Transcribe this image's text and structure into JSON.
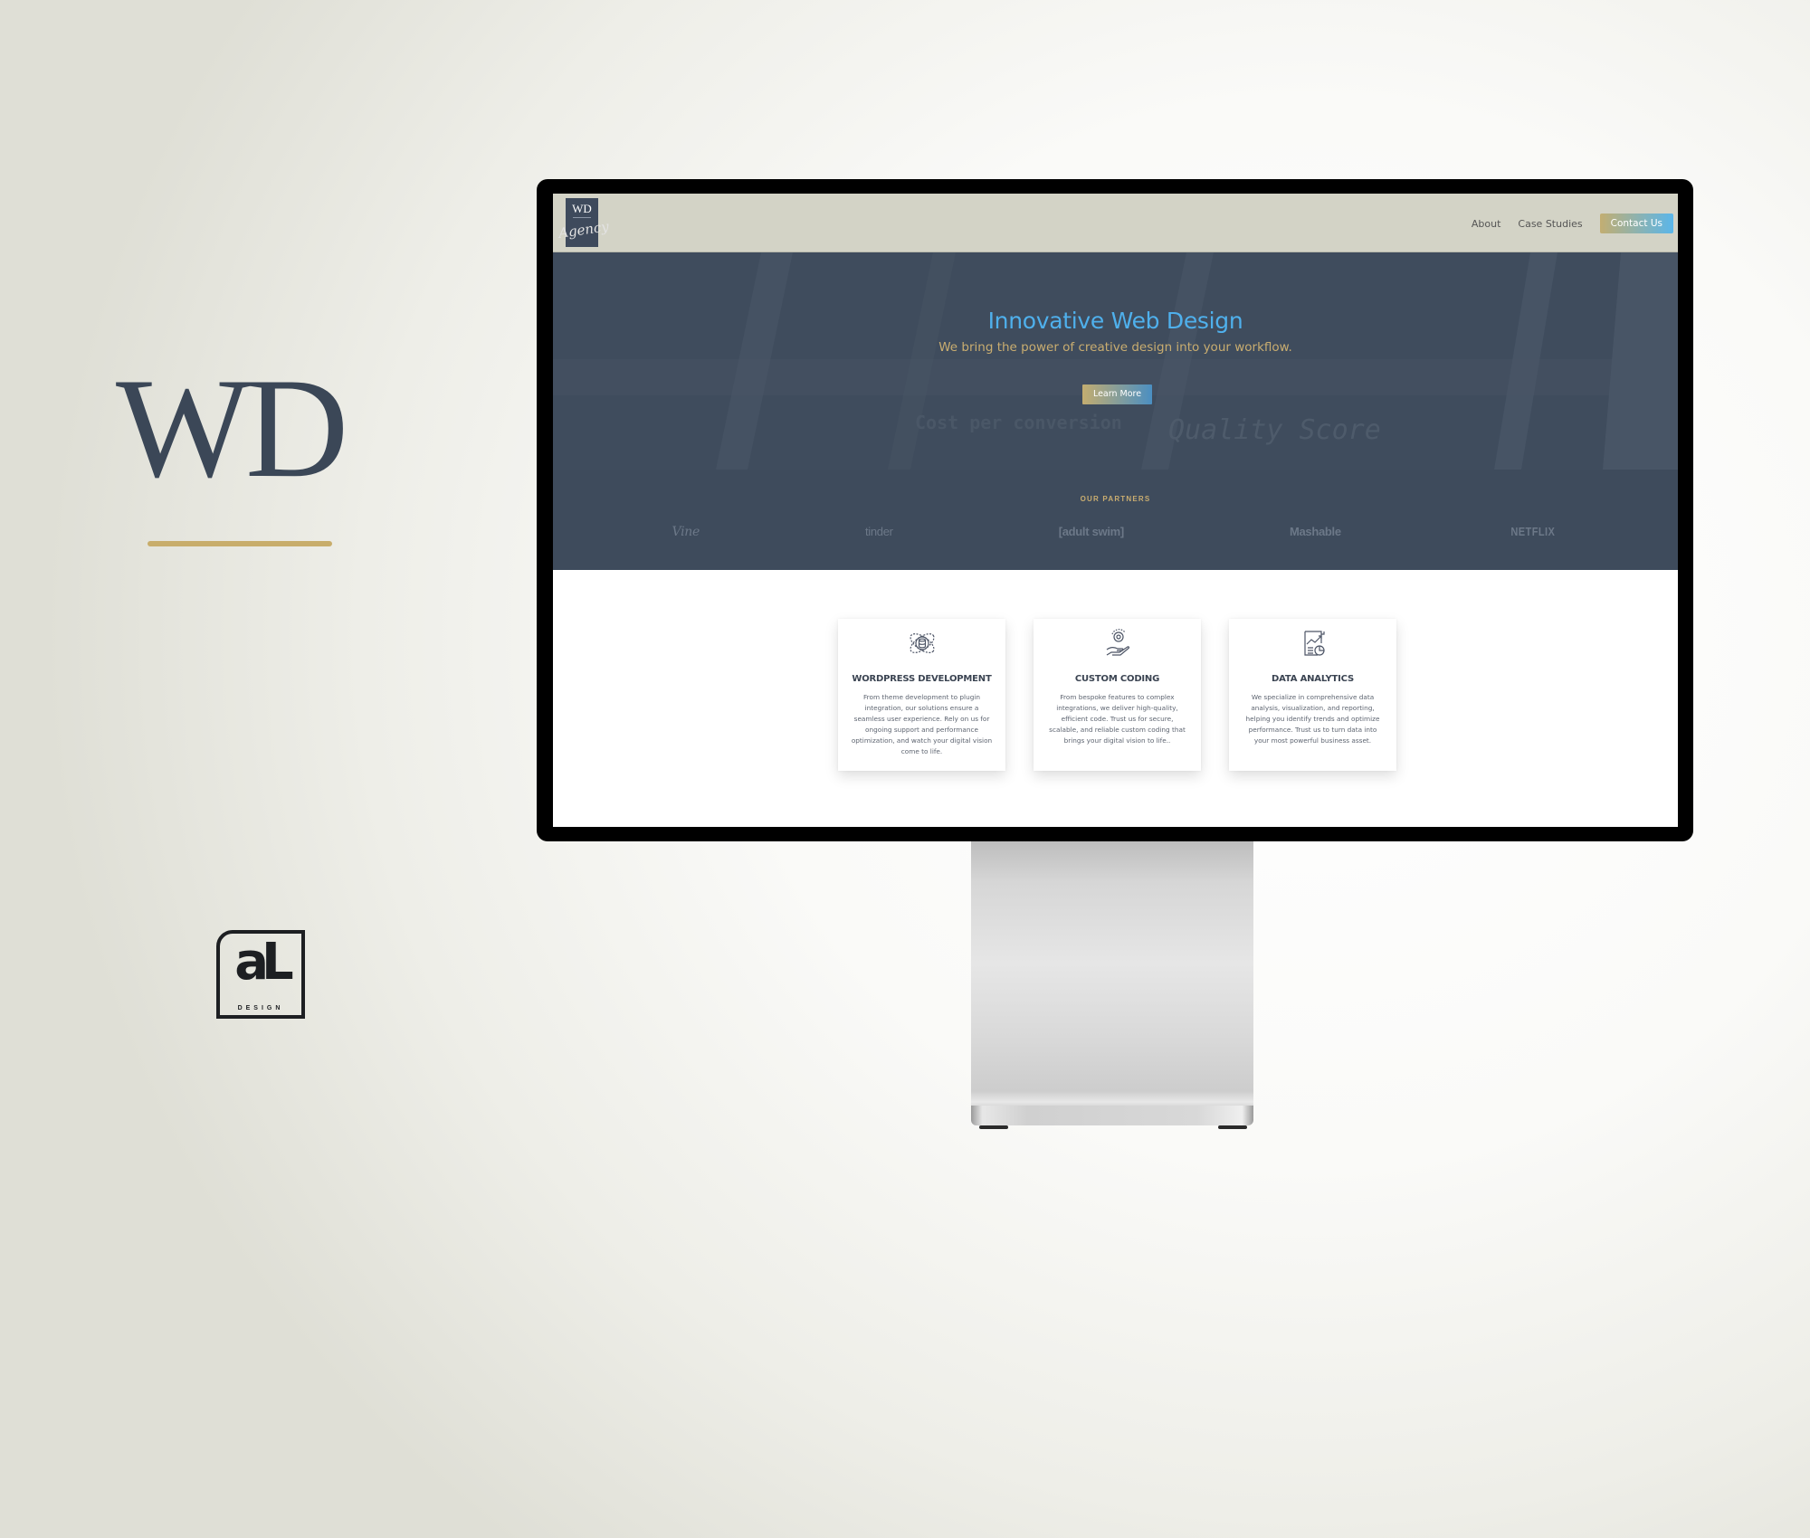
{
  "branding": {
    "monogram": "WD",
    "accent_color": "#c8ad6b",
    "secondary_logo": {
      "glyph": "aL",
      "subtitle": "DESIGN"
    }
  },
  "site": {
    "logo": {
      "monogram": "WD",
      "signature": "Agency"
    },
    "nav": {
      "links": [
        "About",
        "Case Studies"
      ],
      "cta_label": "Contact Us"
    },
    "hero": {
      "title": "Innovative Web Design",
      "subtitle": "We bring the power of creative design into your workflow.",
      "button_label": "Learn More",
      "background_text": [
        "Cost per conversion",
        "Quality Score"
      ]
    },
    "partners": {
      "title": "OUR PARTNERS",
      "logos": [
        "Vine",
        "tinder",
        "[adult swim]",
        "Mashable",
        "NETFLIX"
      ]
    },
    "services": [
      {
        "icon": "database-orbit-icon",
        "title": "WORDPRESS DEVELOPMENT",
        "text": "From theme development to plugin integration, our solutions ensure a seamless user experience. Rely on us for ongoing support and performance optimization, and watch your digital vision come to life."
      },
      {
        "icon": "hand-gear-icon",
        "title": "CUSTOM CODING",
        "text": "From bespoke features to complex integrations, we deliver high-quality, efficient code. Trust us for secure, scalable, and reliable custom coding that brings your digital vision to life.."
      },
      {
        "icon": "report-chart-icon",
        "title": "DATA ANALYTICS",
        "text": "We specialize in comprehensive data analysis, visualization, and reporting, helping you identify trends and optimize performance. Trust us to turn data into your most powerful business asset."
      }
    ],
    "colors": {
      "header_bg": "#d3d3c6",
      "hero_bg": "#3e4b5c",
      "title_blue": "#4fb0ec",
      "gold": "#c9ad70"
    }
  }
}
